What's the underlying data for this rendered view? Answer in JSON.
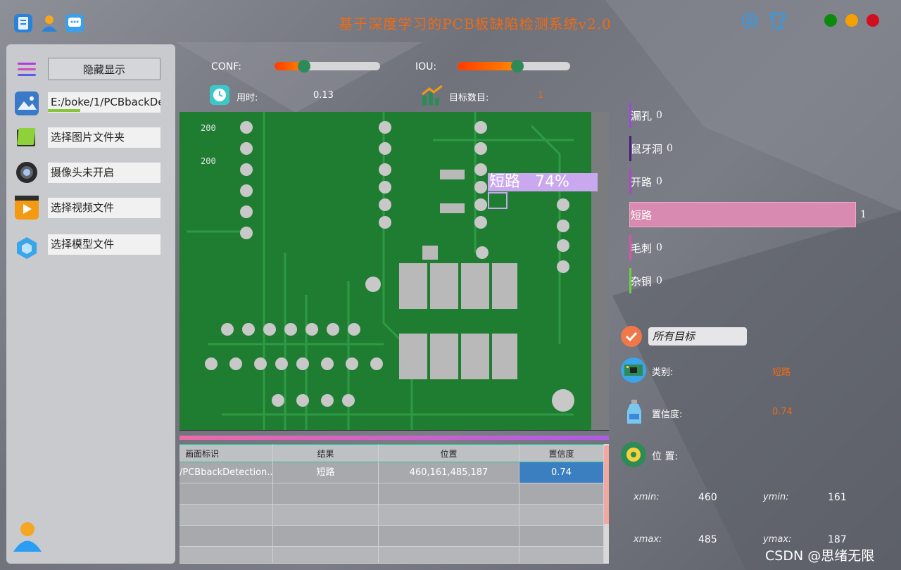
{
  "window": {
    "title": "基于深度学习的PCB板缺陷检测系统v2.0",
    "top_icons": [
      "logo-icon",
      "user-icon",
      "chat-icon"
    ],
    "right_icons": [
      "gear-icon",
      "tshirt-icon"
    ],
    "controls": {
      "close_color": "#d0101e",
      "minimize_color": "#f4a100",
      "maximize_color": "#0a8c0a"
    }
  },
  "sidebar": {
    "menu_icon": "menu-icon",
    "hide_button": "隐藏显示",
    "image_path": "E:/boke/1/PCBbackDetection",
    "image_folder": "选择图片文件夹",
    "camera": "摄像头未开启",
    "video": "选择视频文件",
    "model": "选择模型文件"
  },
  "params": {
    "conf_label": "CONF:",
    "conf_value": 0.28,
    "iou_label": "IOU:",
    "iou_value": 0.53,
    "time_label": "用时:",
    "time_value": "0.13",
    "count_label": "目标数目:",
    "count_value": "1"
  },
  "detection_overlay": {
    "label": "短路",
    "score": "74%"
  },
  "table": {
    "headers": [
      "画面标识",
      "结果",
      "位置",
      "置信度"
    ],
    "rows": [
      [
        "/PCBbackDetection...",
        "短路",
        "460,161,485,187",
        "0.74"
      ]
    ]
  },
  "class_counts": [
    {
      "name": "漏孔",
      "count": 0,
      "color": "#9c4bd8"
    },
    {
      "name": "鼠牙洞",
      "count": 0,
      "color": "#4a1d7a"
    },
    {
      "name": "开路",
      "count": 0,
      "color": "#a84ac8"
    },
    {
      "name": "短路",
      "count": 1,
      "color": "#d98ab0"
    },
    {
      "name": "毛刺",
      "count": 0,
      "color": "#e04fae"
    },
    {
      "name": "杂铜",
      "count": 0,
      "color": "#6ad23a"
    }
  ],
  "filter": {
    "select_value": "所有目标"
  },
  "details": {
    "class_label": "类别:",
    "class_value": "短路",
    "conf_label": "置信度:",
    "conf_value": "0.74",
    "pos_label": "位 置:",
    "xmin_label": "xmin:",
    "xmin": "460",
    "ymin_label": "ymin:",
    "ymin": "161",
    "xmax_label": "xmax:",
    "xmax": "485",
    "ymax_label": "ymax:",
    "ymax": "187"
  },
  "watermark": "CSDN @思绪无限"
}
